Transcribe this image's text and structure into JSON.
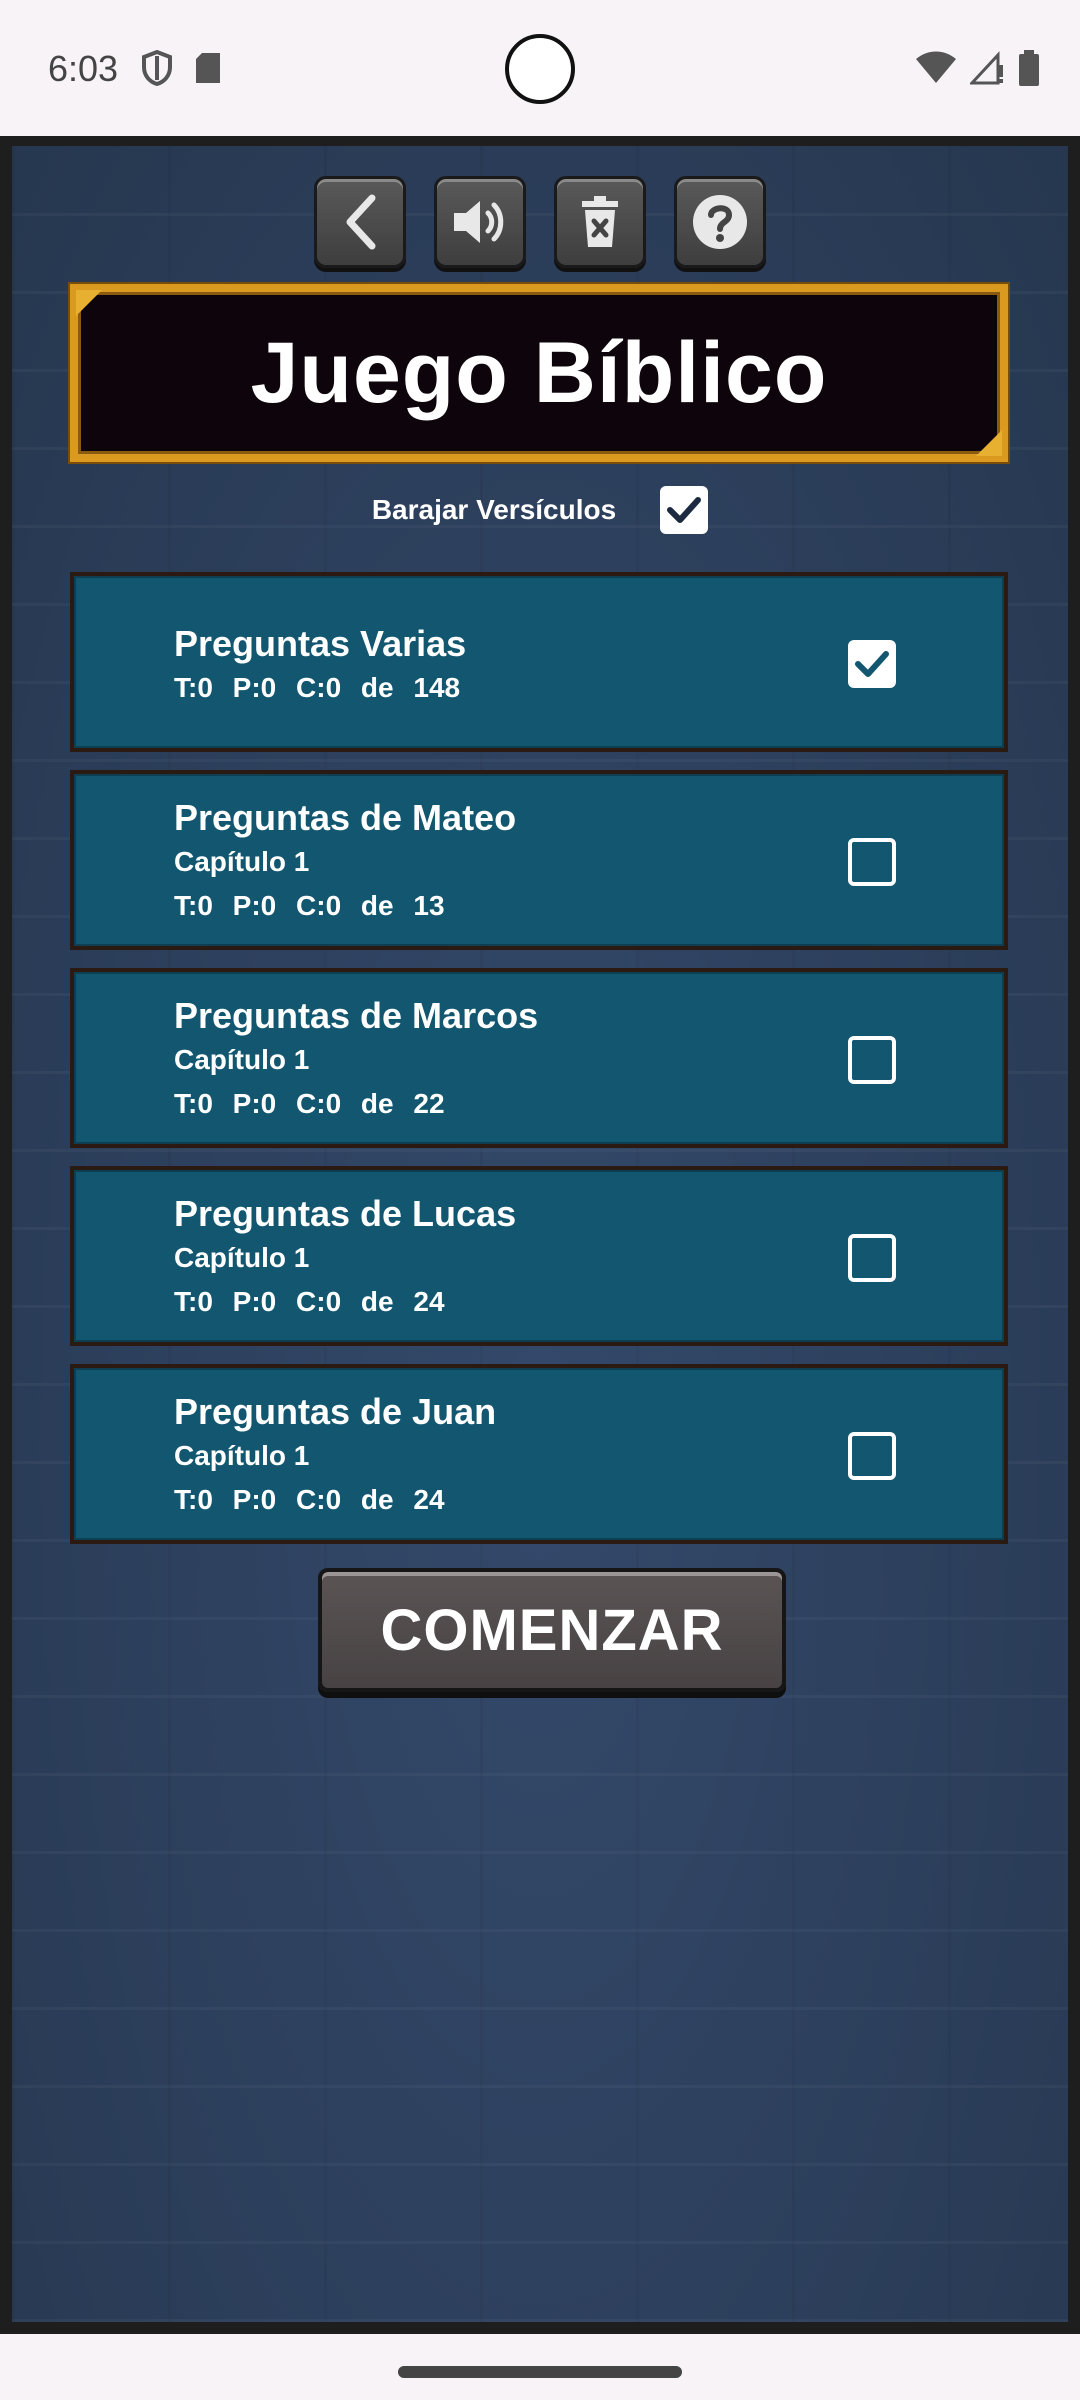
{
  "status_bar": {
    "time": "6:03",
    "left_icons": [
      "shield-icon",
      "sd-card-icon"
    ],
    "right_icons": [
      "wifi-icon",
      "signal-icon",
      "battery-icon"
    ]
  },
  "toolbar": {
    "buttons": [
      {
        "name": "back-button",
        "icon": "chevron-left-icon"
      },
      {
        "name": "sound-button",
        "icon": "speaker-icon"
      },
      {
        "name": "delete-button",
        "icon": "trash-icon"
      },
      {
        "name": "help-button",
        "icon": "question-icon"
      }
    ]
  },
  "title": "Juego Bíblico",
  "shuffle": {
    "label": "Barajar Versículos",
    "checked": true
  },
  "categories": [
    {
      "title": "Preguntas Varias",
      "subtitle": "",
      "stats": "T:0 P:0 C:0 de 148",
      "checked": true
    },
    {
      "title": "Preguntas de Mateo",
      "subtitle": "Capítulo 1",
      "stats": "T:0 P:0 C:0 de 13",
      "checked": false
    },
    {
      "title": "Preguntas de Marcos",
      "subtitle": "Capítulo 1",
      "stats": "T:0 P:0 C:0 de 22",
      "checked": false
    },
    {
      "title": "Preguntas de Lucas",
      "subtitle": "Capítulo 1",
      "stats": "T:0 P:0 C:0 de 24",
      "checked": false
    },
    {
      "title": "Preguntas de Juan",
      "subtitle": "Capítulo 1",
      "stats": "T:0 P:0 C:0 de 24",
      "checked": false
    }
  ],
  "start_button": "COMENZAR",
  "colors": {
    "card_bg": "#125670",
    "frame_gold": "#d99a1f",
    "background": "#2b3f5e"
  }
}
